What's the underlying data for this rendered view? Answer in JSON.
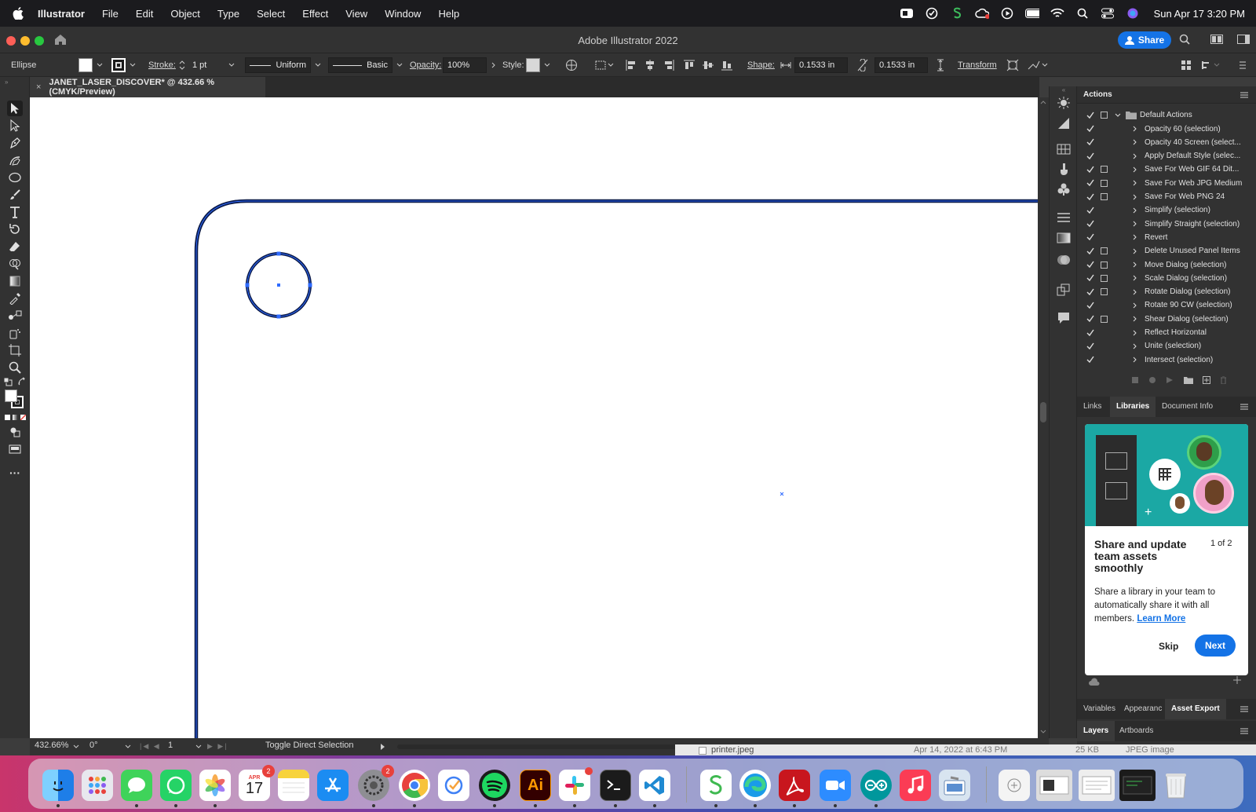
{
  "menubar": {
    "app": "Illustrator",
    "items": [
      "File",
      "Edit",
      "Object",
      "Type",
      "Select",
      "Effect",
      "View",
      "Window",
      "Help"
    ],
    "clock": "Sun Apr 17  3:20 PM"
  },
  "window": {
    "title": "Adobe Illustrator 2022",
    "share_label": "Share"
  },
  "control_bar": {
    "selection_type": "Ellipse",
    "stroke_label": "Stroke:",
    "stroke_value": "1 pt",
    "stroke_profile": "Uniform",
    "brush": "Basic",
    "opacity_label": "Opacity:",
    "opacity_value": "100%",
    "style_label": "Style:",
    "shape_label": "Shape:",
    "width_value": "0.1533 in",
    "height_value": "0.1533 in",
    "transform_label": "Transform"
  },
  "document": {
    "tab_title": "JANET_LASER_DISCOVER* @ 432.66 % (CMYK/Preview)",
    "close_glyph": "×"
  },
  "status_bar": {
    "zoom": "432.66%",
    "rotation": "0°",
    "artboard": "1",
    "status_text": "Toggle Direct Selection"
  },
  "actions_panel": {
    "title": "Actions",
    "set_name": "Default Actions",
    "actions": [
      {
        "label": "Opacity 60 (selection)",
        "dialog": false
      },
      {
        "label": "Opacity 40 Screen (select...",
        "dialog": false
      },
      {
        "label": "Apply Default Style (selec...",
        "dialog": false
      },
      {
        "label": "Save For Web GIF 64 Dit...",
        "dialog": true
      },
      {
        "label": "Save For Web JPG Medium",
        "dialog": true
      },
      {
        "label": "Save For Web PNG 24",
        "dialog": true
      },
      {
        "label": "Simplify (selection)",
        "dialog": false
      },
      {
        "label": "Simplify Straight (selection)",
        "dialog": false
      },
      {
        "label": "Revert",
        "dialog": false
      },
      {
        "label": "Delete Unused Panel Items",
        "dialog": true
      },
      {
        "label": "Move Dialog (selection)",
        "dialog": true
      },
      {
        "label": "Scale Dialog (selection)",
        "dialog": true
      },
      {
        "label": "Rotate Dialog (selection)",
        "dialog": true
      },
      {
        "label": "Rotate 90 CW (selection)",
        "dialog": false
      },
      {
        "label": "Shear Dialog (selection)",
        "dialog": true
      },
      {
        "label": "Reflect Horizontal",
        "dialog": false
      },
      {
        "label": "Unite (selection)",
        "dialog": false
      },
      {
        "label": "Intersect (selection)",
        "dialog": false
      }
    ]
  },
  "libraries_panel": {
    "tabs": [
      "Links",
      "Libraries",
      "Document Info"
    ],
    "active_tab": "Libraries",
    "promo": {
      "title": "Share and update team assets smoothly",
      "counter": "1 of 2",
      "body": "Share a library in your team to automatically share it with all members.",
      "link": "Learn More",
      "skip": "Skip",
      "next": "Next"
    }
  },
  "bottom_panels": {
    "tabs_row1": [
      "Variables",
      "Appearanc",
      "Asset Export"
    ],
    "tabs_row2": [
      "Layers",
      "Artboards"
    ]
  },
  "finder_strip": {
    "filename": "printer.jpeg",
    "date": "Apr 14, 2022 at 6:43 PM",
    "size": "25 KB",
    "kind": "JPEG image"
  },
  "dock": {
    "calendar_month": "APR",
    "calendar_day": "17",
    "calendar_badge": "2",
    "settings_badge": "2",
    "illustrator_label": "Ai"
  },
  "colors": {
    "accent": "#1473e6",
    "selection_blue": "#2f6bff",
    "path_navy": "#0b1a48"
  }
}
